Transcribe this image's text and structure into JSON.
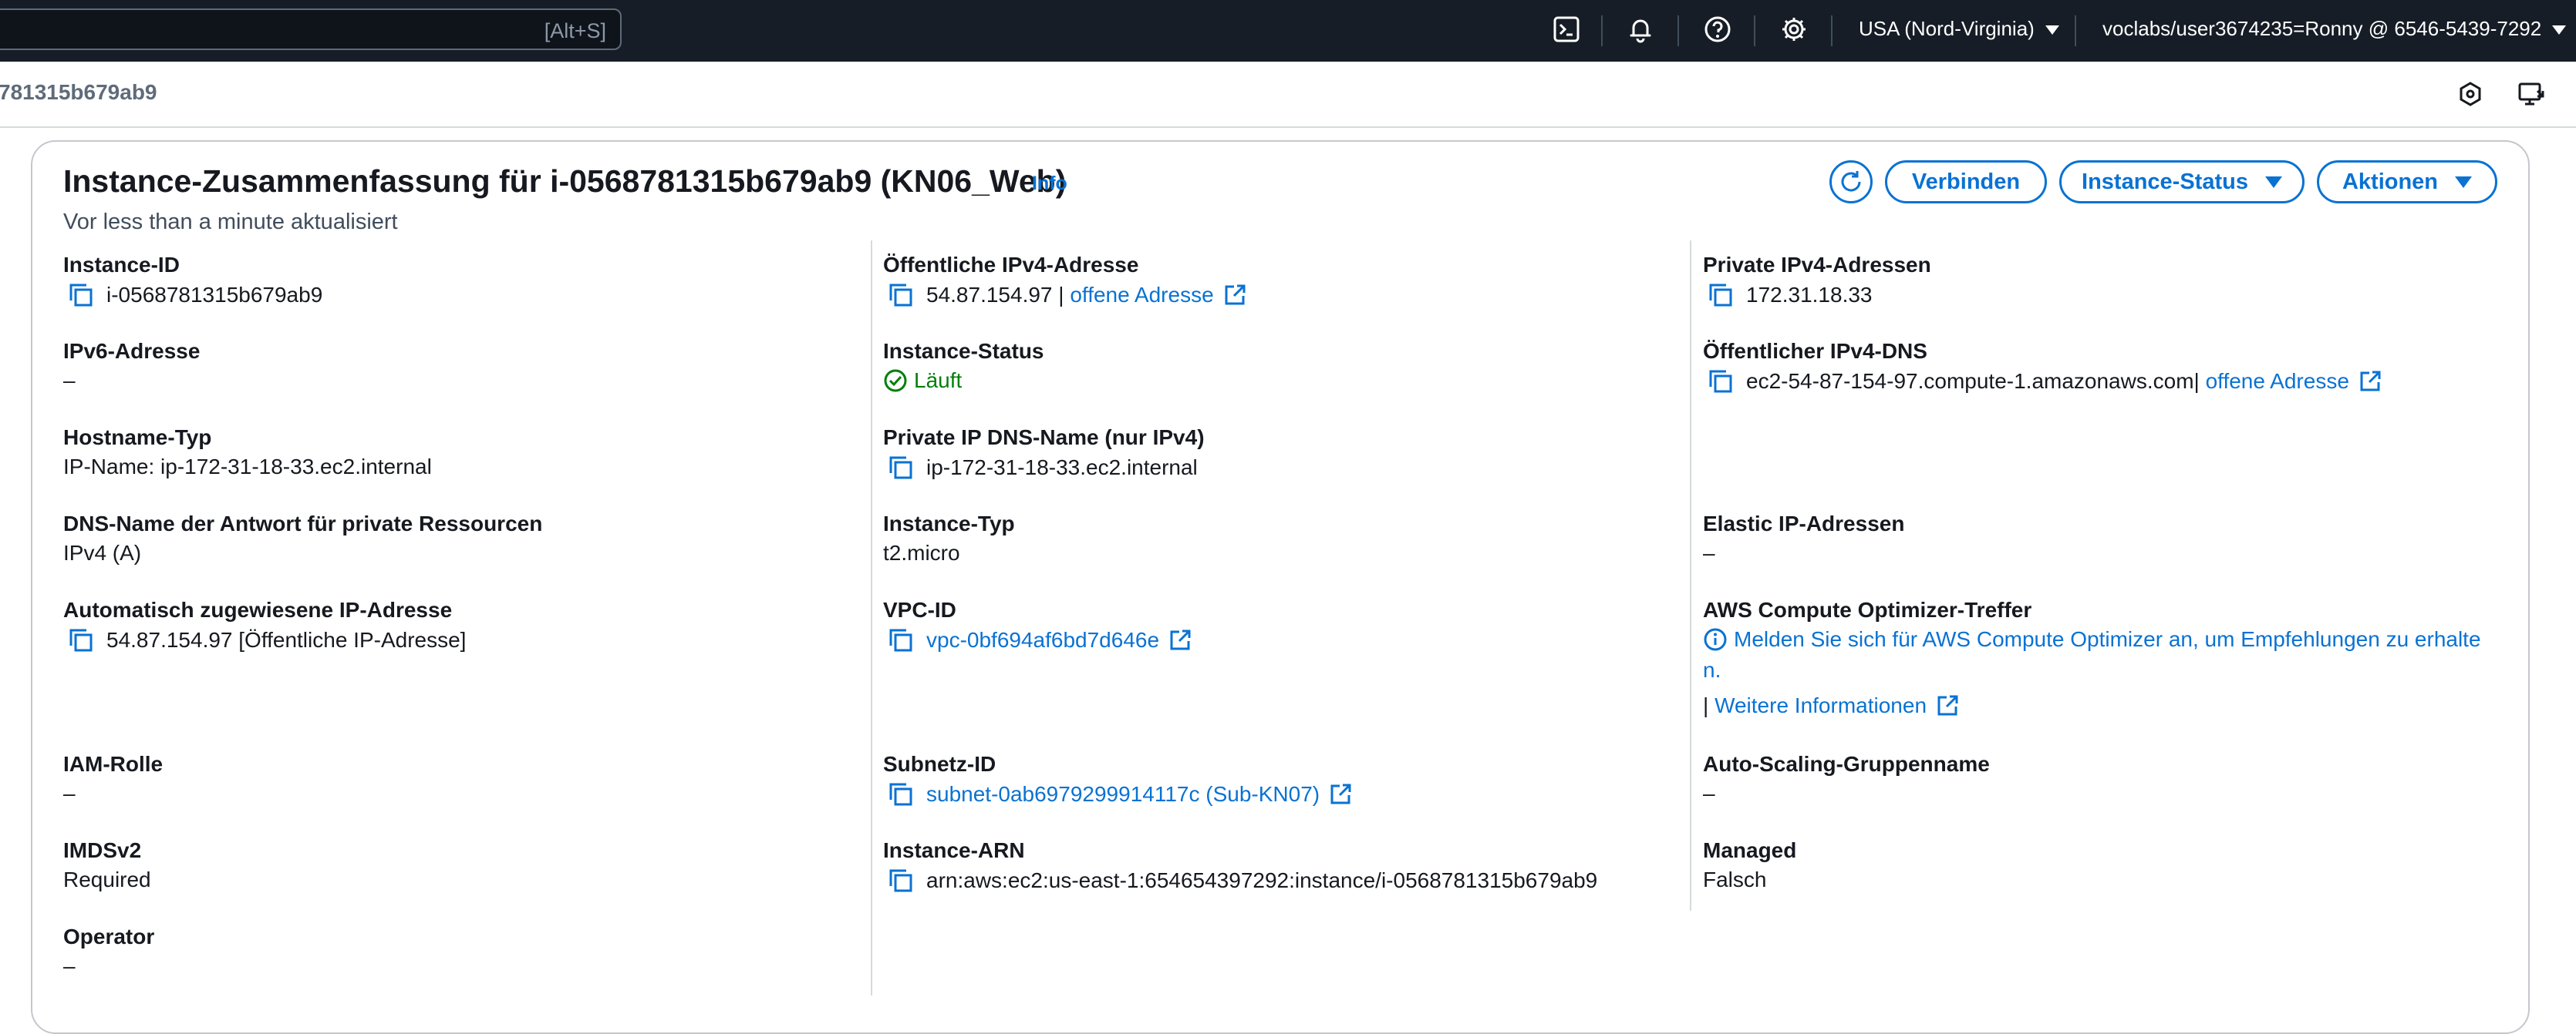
{
  "topbar": {
    "search_shortcut": "[Alt+S]",
    "region": "USA (Nord-Virginia)",
    "account": "voclabs/user3674235=Ronny @ 6546-5439-7292"
  },
  "breadcrumb": "781315b679ab9",
  "summary": {
    "title": "Instance-Zusammenfassung für i-0568781315b679ab9 (KN06_Web)",
    "info_label": "Info",
    "updated": "Vor less than a minute aktualisiert",
    "connect_label": "Verbinden",
    "instance_status_label": "Instance-Status",
    "actions_label": "Aktionen"
  },
  "col1": {
    "instance_id_label": "Instance-ID",
    "instance_id_value": "i-0568781315b679ab9",
    "ipv6_label": "IPv6-Adresse",
    "ipv6_value": "–",
    "hostname_type_label": "Hostname-Typ",
    "hostname_type_value": "IP-Name: ip-172-31-18-33.ec2.internal",
    "dns_answer_label": "DNS-Name der Antwort für private Ressourcen",
    "dns_answer_value": "IPv4 (A)",
    "auto_ip_label": "Automatisch zugewiesene IP-Adresse",
    "auto_ip_value": "54.87.154.97 [Öffentliche IP-Adresse]",
    "iam_label": "IAM-Rolle",
    "iam_value": "–",
    "imdsv2_label": "IMDSv2",
    "imdsv2_value": "Required",
    "operator_label": "Operator",
    "operator_value": "–"
  },
  "col2": {
    "public_ipv4_label": "Öffentliche IPv4-Adresse",
    "public_ipv4_value": "54.87.154.97",
    "public_ipv4_sep": "|",
    "open_address": "offene Adresse",
    "instance_status_label": "Instance-Status",
    "instance_status_value": "Läuft",
    "private_dns_label": "Private IP DNS-Name (nur IPv4)",
    "private_dns_value": "ip-172-31-18-33.ec2.internal",
    "instance_type_label": "Instance-Typ",
    "instance_type_value": "t2.micro",
    "vpc_label": "VPC-ID",
    "vpc_value": "vpc-0bf694af6bd7d646e",
    "subnet_label": "Subnetz-ID",
    "subnet_value": "subnet-0ab6979299914117c (Sub-KN07)",
    "arn_label": "Instance-ARN",
    "arn_value": "arn:aws:ec2:us-east-1:654654397292:instance/i-0568781315b679ab9"
  },
  "col3": {
    "private_ipv4_label": "Private IPv4-Adressen",
    "private_ipv4_value": "172.31.18.33",
    "public_dns_label": "Öffentlicher IPv4-DNS",
    "public_dns_value": "ec2-54-87-154-97.compute-1.amazonaws.com",
    "public_dns_sep": "|",
    "open_address": "offene Adresse",
    "elastic_label": "Elastic IP-Adressen",
    "elastic_value": "–",
    "optimizer_label": "AWS Compute Optimizer-Treffer",
    "optimizer_text_line1": "Melden Sie sich für AWS Compute Optimizer an, um Empfehlungen zu erhalte",
    "optimizer_text_line2": "n.",
    "more_info_sep": "|",
    "more_info": "Weitere Informationen",
    "asg_label": "Auto-Scaling-Gruppenname",
    "asg_value": "–",
    "managed_label": "Managed",
    "managed_value": "Falsch"
  },
  "colors": {
    "link": "#0972d3",
    "success": "#037f0c",
    "topbar": "#161d26"
  }
}
